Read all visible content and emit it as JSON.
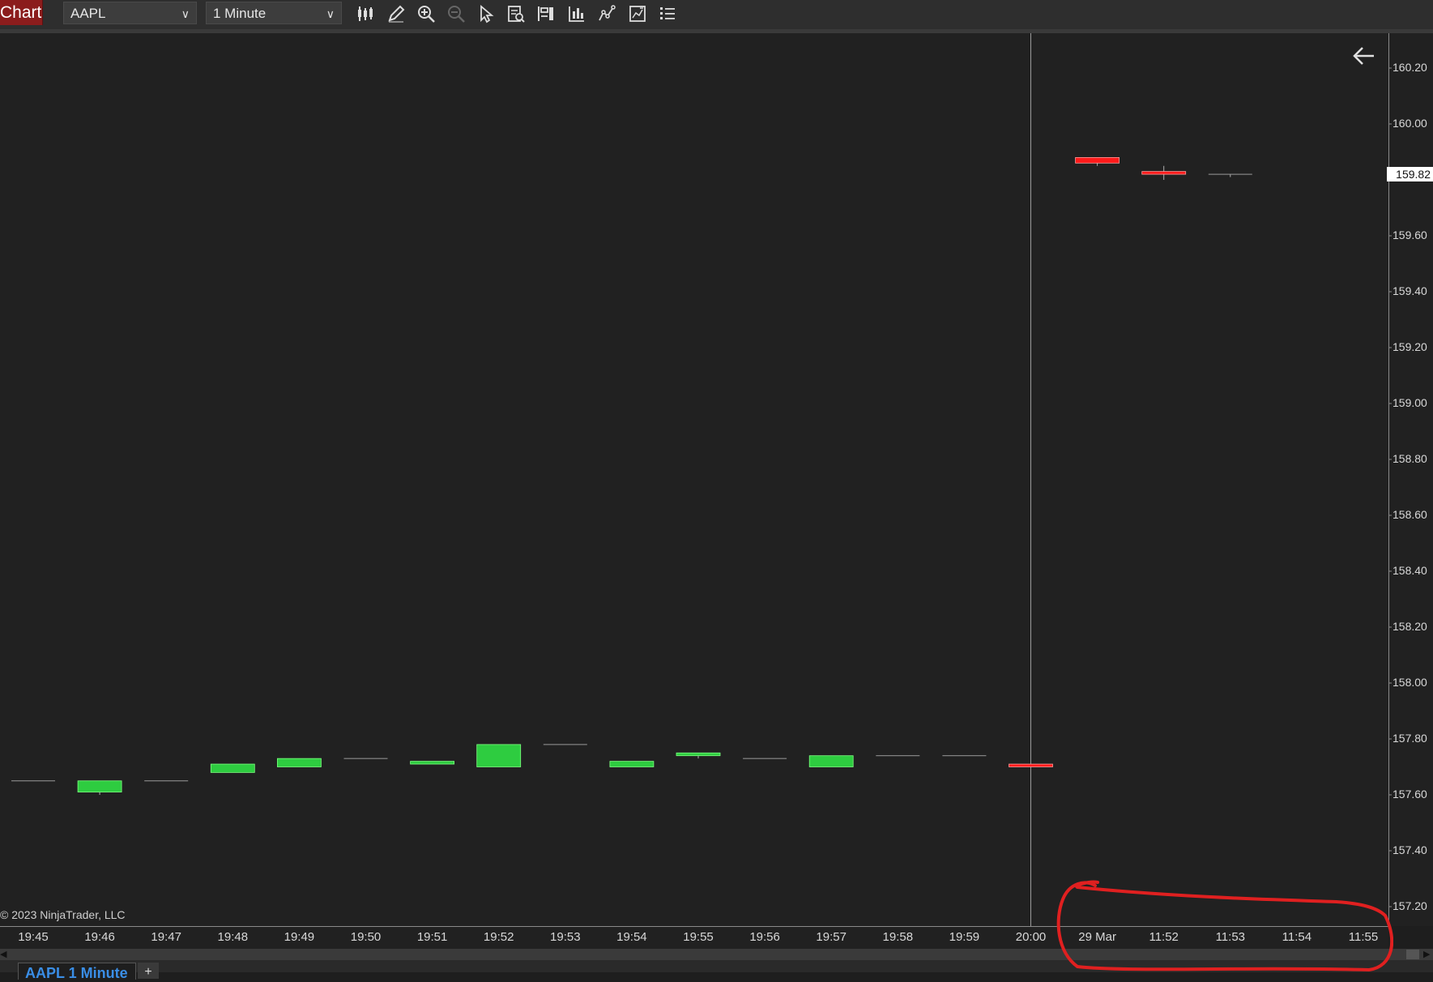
{
  "toolbar": {
    "chart_tab_label": "Chart",
    "instrument": "AAPL",
    "interval": "1 Minute",
    "icons": [
      "bar-type-icon",
      "drawing-tools-icon",
      "zoom-in-icon",
      "zoom-out-icon",
      "pointer-icon",
      "data-box-icon",
      "chart-trader-icon",
      "indicators-icon",
      "strategies-icon",
      "templates-icon",
      "properties-icon"
    ]
  },
  "chart_data": {
    "type": "candlestick",
    "instrument": "AAPL",
    "interval": "1 Minute",
    "x_labels": [
      "19:45",
      "19:46",
      "19:47",
      "19:48",
      "19:49",
      "19:50",
      "19:51",
      "19:52",
      "19:53",
      "19:54",
      "19:55",
      "19:56",
      "19:57",
      "19:58",
      "19:59",
      "20:00",
      "29 Mar",
      "11:52",
      "11:53",
      "11:54",
      "11:55"
    ],
    "y_ticks": [
      "160.20",
      "160.00",
      "159.60",
      "159.40",
      "159.20",
      "159.00",
      "158.80",
      "158.60",
      "158.40",
      "158.20",
      "158.00",
      "157.80",
      "157.60",
      "157.40",
      "157.20"
    ],
    "ylim": [
      157.15,
      160.25
    ],
    "last_price": "159.82",
    "bars": [
      {
        "time": "19:45",
        "open": 157.65,
        "high": 157.65,
        "low": 157.65,
        "close": 157.65
      },
      {
        "time": "19:46",
        "open": 157.61,
        "high": 157.65,
        "low": 157.6,
        "close": 157.65
      },
      {
        "time": "19:47",
        "open": 157.65,
        "high": 157.65,
        "low": 157.65,
        "close": 157.65
      },
      {
        "time": "19:48",
        "open": 157.68,
        "high": 157.71,
        "low": 157.68,
        "close": 157.71
      },
      {
        "time": "19:49",
        "open": 157.7,
        "high": 157.73,
        "low": 157.7,
        "close": 157.73
      },
      {
        "time": "19:50",
        "open": 157.73,
        "high": 157.73,
        "low": 157.73,
        "close": 157.73
      },
      {
        "time": "19:51",
        "open": 157.71,
        "high": 157.72,
        "low": 157.71,
        "close": 157.72
      },
      {
        "time": "19:52",
        "open": 157.7,
        "high": 157.78,
        "low": 157.7,
        "close": 157.78
      },
      {
        "time": "19:53",
        "open": 157.78,
        "high": 157.78,
        "low": 157.78,
        "close": 157.78
      },
      {
        "time": "19:54",
        "open": 157.7,
        "high": 157.72,
        "low": 157.7,
        "close": 157.72
      },
      {
        "time": "19:55",
        "open": 157.74,
        "high": 157.75,
        "low": 157.73,
        "close": 157.75
      },
      {
        "time": "19:56",
        "open": 157.73,
        "high": 157.73,
        "low": 157.73,
        "close": 157.73
      },
      {
        "time": "19:57",
        "open": 157.7,
        "high": 157.74,
        "low": 157.7,
        "close": 157.74
      },
      {
        "time": "19:58",
        "open": 157.74,
        "high": 157.74,
        "low": 157.74,
        "close": 157.74
      },
      {
        "time": "19:59",
        "open": 157.74,
        "high": 157.74,
        "low": 157.74,
        "close": 157.74
      },
      {
        "time": "20:00",
        "open": 157.71,
        "high": 157.71,
        "low": 157.7,
        "close": 157.7
      },
      {
        "time": "29 Mar",
        "open": 159.88,
        "high": 159.88,
        "low": 159.85,
        "close": 159.86
      },
      {
        "time": "11:52",
        "open": 159.83,
        "high": 159.85,
        "low": 159.8,
        "close": 159.82
      },
      {
        "time": "11:53",
        "open": 159.82,
        "high": 159.82,
        "low": 159.81,
        "close": 159.82
      }
    ],
    "up_color": "#2ecc40",
    "down_color": "#ff1a1a",
    "session_break_after": "20:00"
  },
  "copyright": "© 2023 NinjaTrader, LLC",
  "bottom_tab": {
    "label": "AAPL 1 Minute",
    "add_label": "+"
  }
}
